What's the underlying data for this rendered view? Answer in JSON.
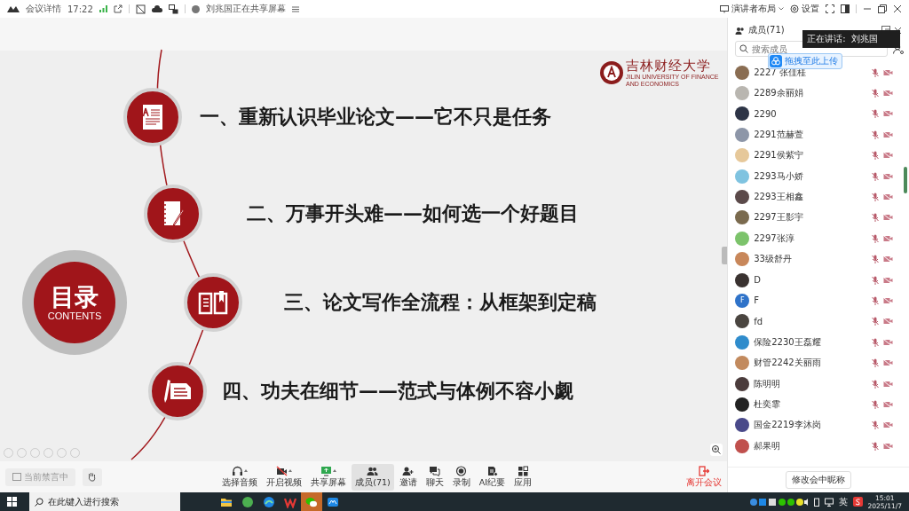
{
  "top_bar": {
    "app_label": "会议详情",
    "time": "17:22",
    "sharing_notice": "刘兆国正在共享屏幕",
    "layout_button": "演讲者布局",
    "settings_button": "设置"
  },
  "slide": {
    "badge_title": "目录",
    "badge_subtitle": "CONTENTS",
    "logo_name": "吉林财经大学",
    "logo_subtitle": "JILIN UNIVERSITY OF FINANCE AND ECONOMICS",
    "items": [
      {
        "text": "一、重新认识毕业论文——它不只是任务",
        "kind": "document"
      },
      {
        "text": "二、万事开头难——如何选一个好题目",
        "kind": "notebook"
      },
      {
        "text": "三、论文写作全流程：从框架到定稿",
        "kind": "book"
      },
      {
        "text": "四、功夫在细节——范式与体例不容小觑",
        "kind": "pen"
      }
    ]
  },
  "members_panel": {
    "title": "成员(71)",
    "speaking_label": "正在讲话:",
    "speaker": "刘兆国",
    "search_placeholder": "搜索成员",
    "upload_hint": "拖拽至此上传",
    "members": [
      {
        "name": "2227 张佳桂",
        "kind": "photo",
        "muted": true
      },
      {
        "name": "2289余丽娟",
        "kind": "photo",
        "muted": true
      },
      {
        "name": "2290",
        "kind": "photo",
        "muted": true
      },
      {
        "name": "2291范赫萱",
        "kind": "photo",
        "muted": true
      },
      {
        "name": "2291侯紫宁",
        "kind": "photo",
        "muted": true
      },
      {
        "name": "2293马小娇",
        "kind": "photo",
        "muted": true
      },
      {
        "name": "2293王相鑫",
        "kind": "photo",
        "muted": true
      },
      {
        "name": "2297王影宇",
        "kind": "photo",
        "muted": true
      },
      {
        "name": "2297张淳",
        "kind": "photo",
        "muted": true
      },
      {
        "name": "33级舒丹",
        "kind": "photo",
        "muted": true
      },
      {
        "name": "D",
        "kind": "photo",
        "muted": true
      },
      {
        "name": "F",
        "kind": "letter",
        "initial": "F",
        "muted": true
      },
      {
        "name": "fd",
        "kind": "photo",
        "muted": true
      },
      {
        "name": "保险2230王磊耀",
        "kind": "photo",
        "muted": true
      },
      {
        "name": "财管2242关丽雨",
        "kind": "photo",
        "muted": true
      },
      {
        "name": "陈明明",
        "kind": "photo",
        "muted": true
      },
      {
        "name": "杜奕霏",
        "kind": "photo",
        "muted": true
      },
      {
        "name": "国金2219李沐岗",
        "kind": "photo",
        "muted": true
      },
      {
        "name": "郝果明",
        "kind": "photo",
        "muted": true
      }
    ],
    "rename_button": "修改会中昵称"
  },
  "toolbar": {
    "mute_notice": "当前禁言中",
    "buttons": [
      {
        "label": "选择音频",
        "kind": "headset",
        "has_menu": true,
        "selected": false
      },
      {
        "label": "开启视频",
        "kind": "camera-off",
        "has_menu": true,
        "selected": false
      },
      {
        "label": "共享屏幕",
        "kind": "share",
        "has_menu": true,
        "selected": false
      },
      {
        "label": "成员(71)",
        "kind": "people",
        "has_menu": false,
        "selected": true
      },
      {
        "label": "邀请",
        "kind": "invite",
        "has_menu": false,
        "selected": false
      },
      {
        "label": "聊天",
        "kind": "chat",
        "has_menu": false,
        "selected": false
      },
      {
        "label": "录制",
        "kind": "record",
        "has_menu": false,
        "selected": false
      },
      {
        "label": "AI纪要",
        "kind": "ai",
        "has_menu": false,
        "selected": false
      },
      {
        "label": "应用",
        "kind": "apps",
        "has_menu": false,
        "selected": false
      }
    ],
    "leave_button": "离开会议"
  },
  "taskbar": {
    "search_placeholder": "在此键入进行搜索",
    "apps": [
      {
        "kind": "folder",
        "active": false
      },
      {
        "kind": "green",
        "active": false
      },
      {
        "kind": "browser",
        "active": false
      },
      {
        "kind": "wps",
        "active": false
      },
      {
        "kind": "chat",
        "active": true
      },
      {
        "kind": "meeting",
        "active": false
      }
    ],
    "ime": "英",
    "time": "15:01",
    "date": "2025/11/7"
  }
}
